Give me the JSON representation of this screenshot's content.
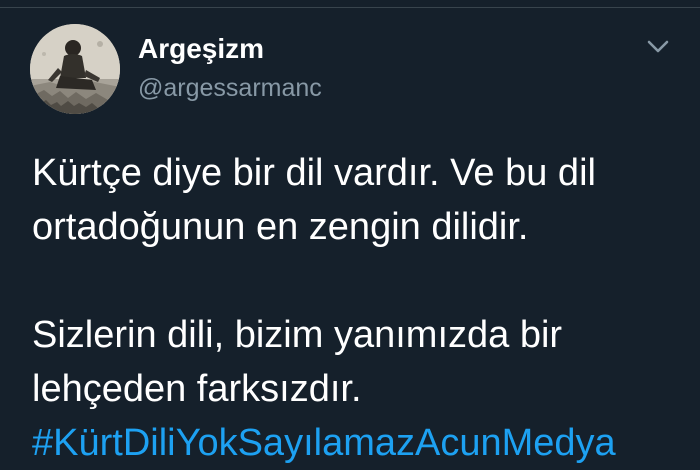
{
  "user": {
    "display_name": "Argeşizm",
    "handle": "@argessarmanc",
    "avatar_icon": "profile-photo"
  },
  "menu": {
    "icon": "chevron-down-icon"
  },
  "tweet": {
    "lines": [
      "Kürtçe diye bir dil vardır. Ve bu dil",
      "ortadoğunun en zengin dilidir.",
      "Sizlerin dili, bizim yanımızda bir",
      "lehçeden farksızdır."
    ],
    "hashtag": "#KürtDiliYokSayılamazAcunMedya"
  },
  "colors": {
    "background": "#15202b",
    "text": "#ffffff",
    "secondary_text": "#8899a6",
    "link": "#1da1f2",
    "divider": "#38444d"
  }
}
